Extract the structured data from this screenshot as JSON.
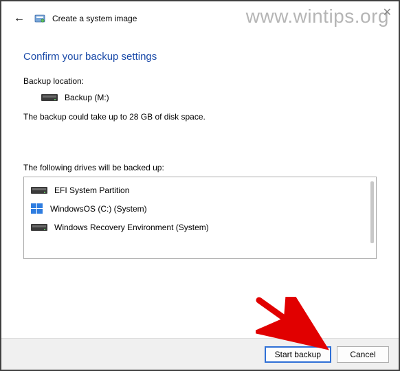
{
  "watermark": "www.wintips.org",
  "window": {
    "title": "Create a system image"
  },
  "page": {
    "heading": "Confirm your backup settings",
    "backup_location_label": "Backup location:",
    "backup_location_value": "Backup (M:)",
    "size_note": "The backup could take up to 28 GB of disk space.",
    "drives_label": "The following drives will be backed up:",
    "drives": [
      {
        "icon": "drive",
        "name": "EFI System Partition"
      },
      {
        "icon": "windows",
        "name": "WindowsOS (C:) (System)"
      },
      {
        "icon": "drive",
        "name": "Windows Recovery Environment (System)"
      }
    ]
  },
  "buttons": {
    "start": "Start backup",
    "cancel": "Cancel"
  }
}
